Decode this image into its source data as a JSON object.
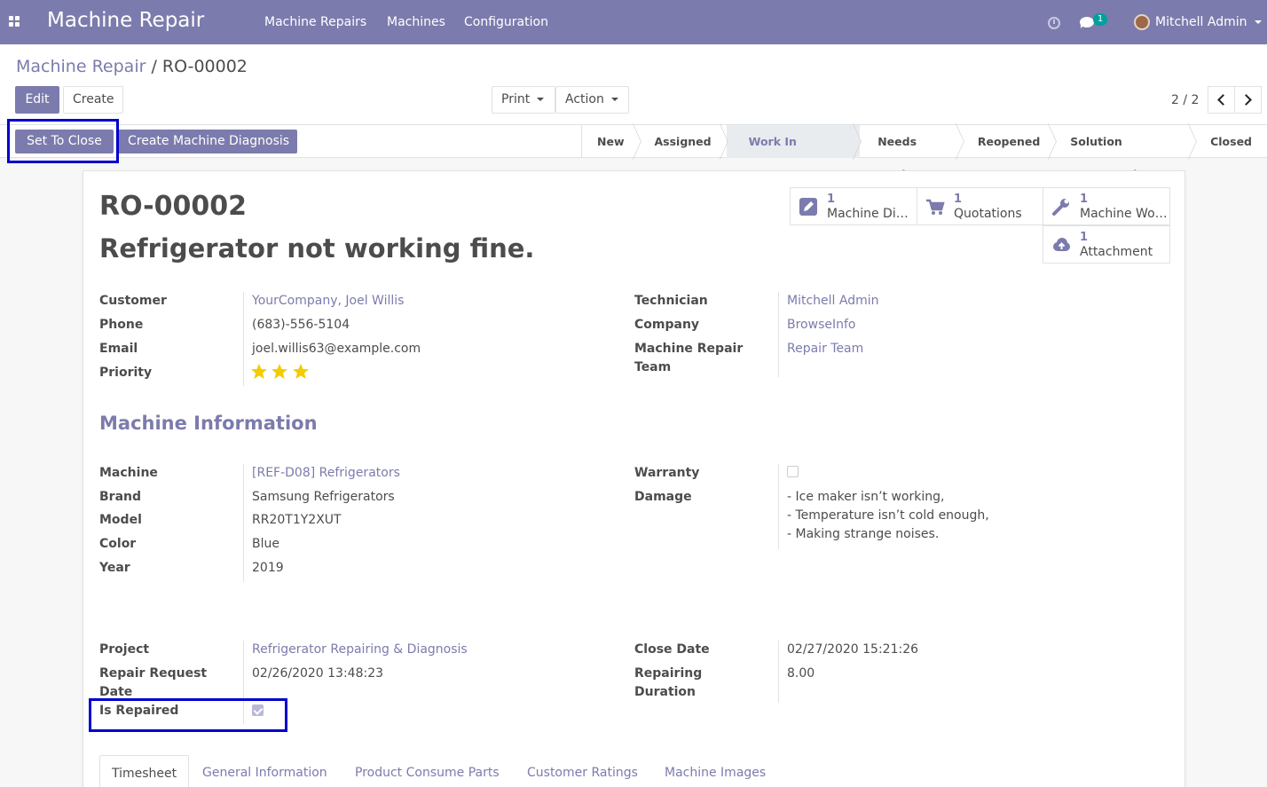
{
  "navbar": {
    "app_name": "Machine Repair",
    "menu": [
      "Machine Repairs",
      "Machines",
      "Configuration"
    ],
    "chat_badge": "1",
    "user": "Mitchell Admin"
  },
  "breadcrumb": {
    "parent": "Machine Repair",
    "separator": "/",
    "current": "RO-00002"
  },
  "buttons": {
    "edit": "Edit",
    "create": "Create",
    "print": "Print",
    "action": "Action",
    "set_to_close": "Set To Close",
    "create_diagnosis": "Create Machine Diagnosis"
  },
  "pager": {
    "value": "2 / 2"
  },
  "stages": [
    {
      "label": "New",
      "active": false
    },
    {
      "label": "Assigned",
      "active": false
    },
    {
      "label": "Work In Progress",
      "active": true
    },
    {
      "label": "Needs Reply",
      "active": false
    },
    {
      "label": "Reopened",
      "active": false
    },
    {
      "label": "Solution Suggested",
      "active": false
    },
    {
      "label": "Closed",
      "active": false
    }
  ],
  "record": {
    "reference": "RO-00002",
    "subject": "Refrigerator not working fine."
  },
  "smart_buttons": [
    {
      "count": "1",
      "label": "Machine Diagnosis",
      "icon": "pencil-icon"
    },
    {
      "count": "1",
      "label": "Quotations",
      "icon": "cart-icon"
    },
    {
      "count": "1",
      "label": "Machine Work Orders",
      "icon": "wrench-icon"
    },
    {
      "count": "1",
      "label": "Attachment",
      "icon": "cloud-upload-icon"
    }
  ],
  "left_fields": [
    {
      "label": "Customer",
      "value": "YourCompany, Joel Willis",
      "link": true
    },
    {
      "label": "Phone",
      "value": "(683)-556-5104",
      "link": false
    },
    {
      "label": "Email",
      "value": "joel.willis63@example.com",
      "link": false
    },
    {
      "label": "Priority",
      "value": "",
      "link": false
    }
  ],
  "priority": {
    "stars": 3,
    "max": 3
  },
  "right_fields": [
    {
      "label": "Technician",
      "value": "Mitchell Admin"
    },
    {
      "label": "Company",
      "value": "BrowseInfo"
    },
    {
      "label": "Machine Repair Team",
      "value": "Repair Team"
    }
  ],
  "machine_section": "Machine Information",
  "machine_fields": [
    {
      "label": "Machine",
      "value": "[REF-D08] Refrigerators",
      "link": true
    },
    {
      "label": "Brand",
      "value": "Samsung Refrigerators",
      "link": false
    },
    {
      "label": "Model",
      "value": "RR20T1Y2XUT",
      "link": false
    },
    {
      "label": "Color",
      "value": "Blue",
      "link": false
    },
    {
      "label": "Year",
      "value": "2019",
      "link": false
    }
  ],
  "warranty": {
    "label": "Warranty",
    "checked": false
  },
  "damage": {
    "label": "Damage",
    "lines": [
      "- Ice maker isn’t working,",
      "- Temperature isn’t cold enough,",
      "- Making strange noises."
    ]
  },
  "project": {
    "label": "Project",
    "value": "Refrigerator Repairing & Diagnosis"
  },
  "request_date": {
    "label": "Repair Request Date",
    "value": "02/26/2020 13:48:23"
  },
  "is_repaired": {
    "label": "Is Repaired",
    "checked": true
  },
  "close_date": {
    "label": "Close Date",
    "value": "02/27/2020 15:21:26"
  },
  "duration": {
    "label": "Repairing Duration",
    "value": "8.00"
  },
  "tabs": [
    {
      "label": "Timesheet",
      "active": true
    },
    {
      "label": "General Information",
      "active": false
    },
    {
      "label": "Product Consume Parts",
      "active": false
    },
    {
      "label": "Customer Ratings",
      "active": false
    },
    {
      "label": "Machine Images",
      "active": false
    }
  ],
  "colors": {
    "brand": "#7c7bad",
    "highlight": "#0000cc",
    "star": "#f3cc00"
  }
}
